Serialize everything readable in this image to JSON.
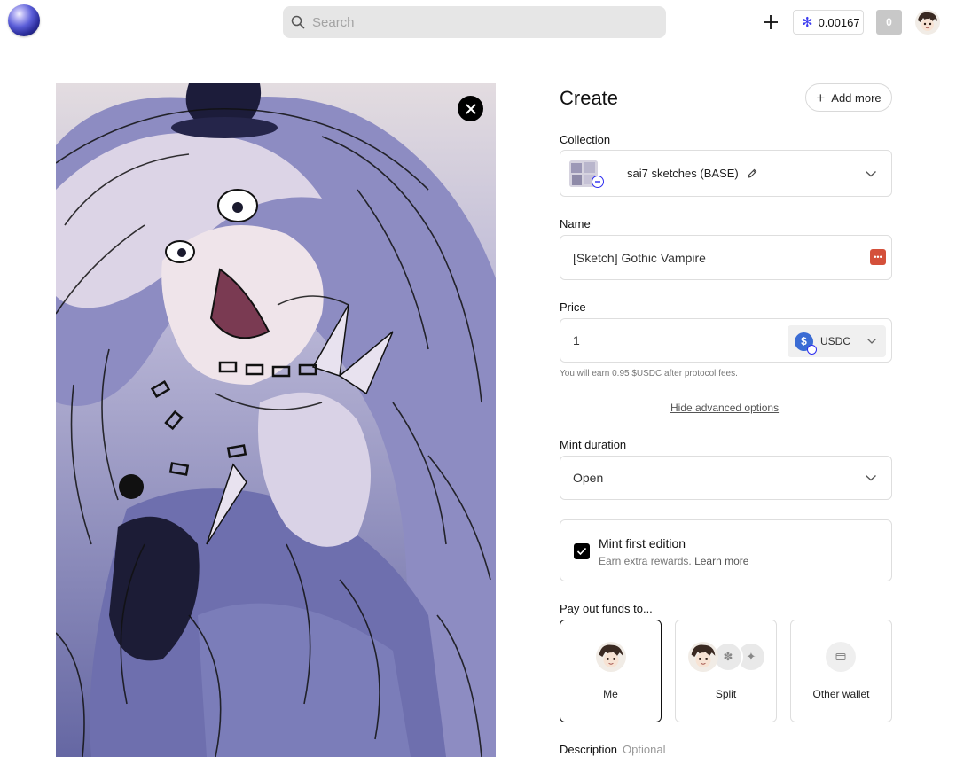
{
  "header": {
    "search_placeholder": "Search",
    "balance": "0.00167",
    "notifications_count": "0"
  },
  "form": {
    "title": "Create",
    "add_more": "Add more",
    "collection": {
      "label": "Collection",
      "value": "sai7 sketches (BASE)"
    },
    "name": {
      "label": "Name",
      "value": "[Sketch] Gothic Vampire"
    },
    "price": {
      "label": "Price",
      "value": "1",
      "currency": "USDC",
      "fee_note": "You will earn 0.95 $USDC after protocol fees."
    },
    "advanced_toggle": "Hide advanced options",
    "mint_duration": {
      "label": "Mint duration",
      "value": "Open"
    },
    "mint_first": {
      "title": "Mint first edition",
      "subtitle": "Earn extra rewards.",
      "link": "Learn more",
      "checked": true
    },
    "payout": {
      "label": "Pay out funds to...",
      "options": [
        "Me",
        "Split",
        "Other wallet"
      ],
      "selected": "Me"
    },
    "description": {
      "label": "Description",
      "optional": "Optional"
    }
  },
  "colors": {
    "accent": "#2d2df0",
    "artwork_tint": "#6c6ea8"
  }
}
